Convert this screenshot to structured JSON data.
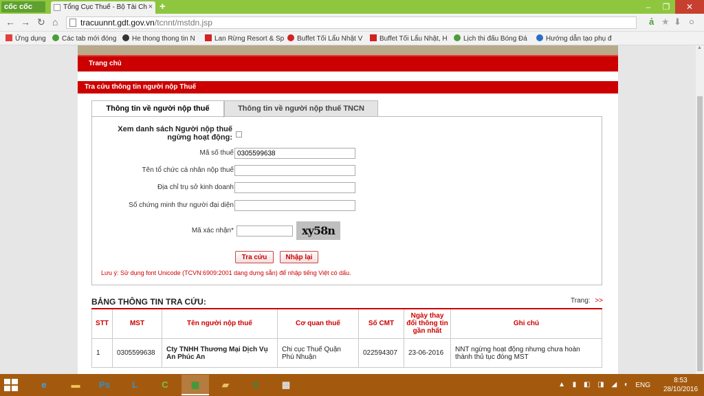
{
  "browser": {
    "brand": "cốc cốc",
    "tab_title": "Tổng Cục Thuế - Bộ Tài Ch",
    "tab_close": "×",
    "new_tab": "+",
    "url_host": "tracuunnt.gdt.gov.vn",
    "url_path": "/tcnnt/mstdn.jsp",
    "win_min": "–",
    "win_max": "❐",
    "win_close": "✕"
  },
  "bookmarks": [
    {
      "label": "Ứng dụng",
      "icon": "apps-grid-icon",
      "color": "#e04040"
    },
    {
      "label": "Các tab mới đóng",
      "icon": "history-icon",
      "color": "#4a9e3a"
    },
    {
      "label": "He thong thong tin N",
      "icon": "globe-icon",
      "color": "#333333"
    },
    {
      "label": "Lan Rừng Resort & Sp",
      "icon": "h-logo-icon",
      "color": "#d22222"
    },
    {
      "label": "Buffet Tối Lẩu Nhật V",
      "icon": "pin-icon",
      "color": "#d22222"
    },
    {
      "label": "Buffet Tối Lẩu Nhật, H",
      "icon": "h-logo-icon",
      "color": "#d22222"
    },
    {
      "label": "Lịch thi đấu Bóng Đá",
      "icon": "ball-icon",
      "color": "#4a9e3a"
    },
    {
      "label": "Hướng dẫn tạo phụ đ",
      "icon": "guide-icon",
      "color": "#2a6ec9"
    }
  ],
  "site": {
    "menu_home": "Trang chủ",
    "panel_title": "Tra cứu thông tin người nộp Thuế",
    "tab_active": "Thông tin về người nộp thuế",
    "tab_inactive": "Thông tin về người nộp thuế TNCN",
    "form": {
      "inactive_label": "Xem danh sách Người nộp thuế ngừng hoạt động:",
      "tax_code_label": "Mã số thuế",
      "tax_code_value": "0305599638",
      "name_label": "Tên tổ chức cá nhân nộp thuế",
      "address_label": "Địa chỉ trụ sở kinh doanh",
      "id_label": "Số chứng minh thư người đại diện",
      "captcha_label": "Mã xác nhận*",
      "captcha_text": "xy58n",
      "search_button": "Tra cứu",
      "reset_button": "Nhập lại",
      "note": "Lưu ý: Sử dụng font Unicode (TCVN:6909:2001 dang dựng sẵn) để nhập tiếng Việt có dấu."
    },
    "results": {
      "title": "BẢNG THÔNG TIN TRA CỨU:",
      "pager_label": "Trang:",
      "pager_next": ">>",
      "headers": [
        "STT",
        "MST",
        "Tên người nộp thuế",
        "Cơ quan thuế",
        "Số CMT",
        "Ngày thay đổi thông tin gần nhất",
        "Ghi chú"
      ],
      "rows": [
        [
          "1",
          "0305599638",
          "Cty TNHH Thương Mại Dịch Vụ An Phúc An",
          "Chi cục Thuế Quận Phú Nhuận",
          "022594307",
          "23-06-2016",
          "NNT ngừng hoạt động nhưng chưa hoàn thành thủ tục đóng MST"
        ]
      ]
    }
  },
  "taskbar": {
    "apps": [
      {
        "name": "internet-explorer-icon",
        "glyph": "e",
        "color": "#3aa0e8"
      },
      {
        "name": "file-explorer-icon",
        "glyph": "▬",
        "color": "#f2c35a"
      },
      {
        "name": "photoshop-icon",
        "glyph": "Ps",
        "color": "#2b8fd6"
      },
      {
        "name": "lync-icon",
        "glyph": "L",
        "color": "#3b8dd0"
      },
      {
        "name": "coccoc-icon",
        "glyph": "C",
        "color": "#7cc142"
      },
      {
        "name": "store-icon",
        "glyph": "▦",
        "color": "#3a9b3a"
      },
      {
        "name": "folder-icon",
        "glyph": "▰",
        "color": "#e8c16a"
      },
      {
        "name": "excel-icon",
        "glyph": "X",
        "color": "#2a8a3e"
      },
      {
        "name": "network-icon",
        "glyph": "▩",
        "color": "#dddddd"
      }
    ],
    "lang": "ENG",
    "time": "8:53",
    "date": "28/10/2016"
  }
}
